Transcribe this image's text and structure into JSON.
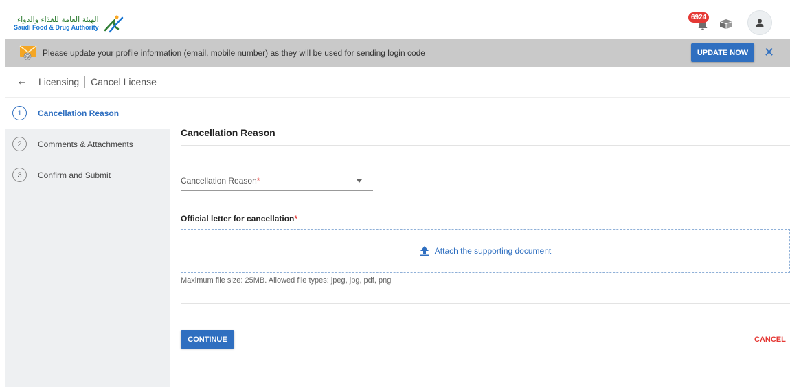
{
  "header": {
    "logo_ar": "الهيئة العامة للغذاء والدواء",
    "logo_en": "Saudi Food & Drug Authority",
    "notification_count": "6924",
    "icons": [
      "bell-icon",
      "box-icon",
      "user-icon"
    ]
  },
  "banner": {
    "message": "Please update your profile information (email, mobile number) as they will be used for sending login code",
    "update_label": "UPDATE NOW",
    "close_symbol": "✕"
  },
  "breadcrumb": {
    "items": [
      "Licensing",
      "Cancel License"
    ]
  },
  "steps": [
    {
      "num": "1",
      "label": "Cancellation Reason",
      "active": true
    },
    {
      "num": "2",
      "label": "Comments & Attachments",
      "active": false
    },
    {
      "num": "3",
      "label": "Confirm and Submit",
      "active": false
    }
  ],
  "form": {
    "section_title": "Cancellation Reason",
    "reason_label": "Cancellation Reason",
    "required_mark": "*",
    "letter_label": "Official letter for cancellation",
    "attach_text": "Attach the supporting document",
    "hint": "Maximum file size: 25MB. Allowed file types: jpeg, jpg, pdf, png",
    "continue_label": "CONTINUE",
    "cancel_label": "CANCEL"
  },
  "colors": {
    "primary": "#2f6fc0",
    "danger": "#e53935",
    "banner_bg": "#c9c9c9",
    "sidebar_bg": "#eef0f2"
  }
}
